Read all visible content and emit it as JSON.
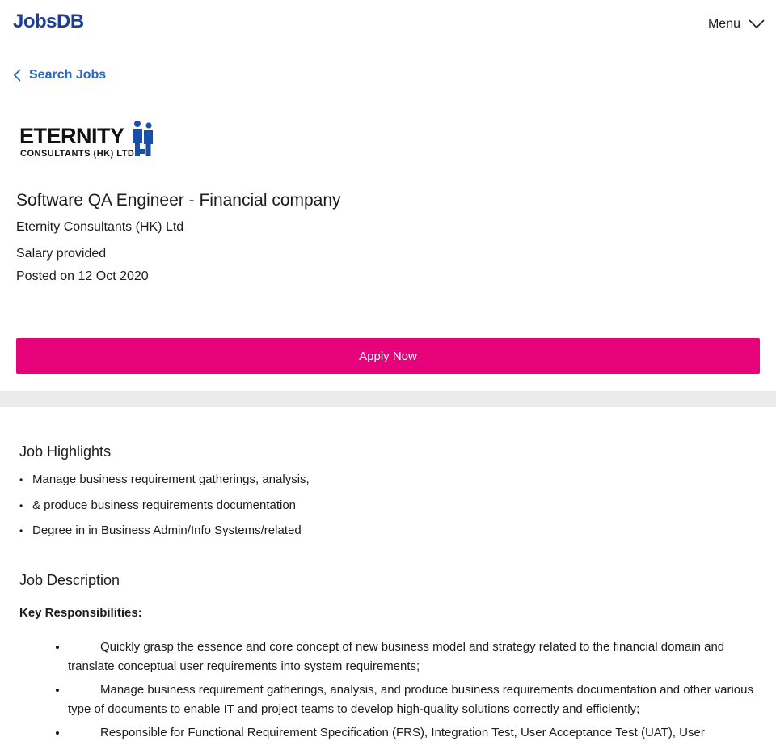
{
  "header": {
    "logo_text": "JobsDB",
    "menu_label": "Menu"
  },
  "nav": {
    "back_label": "Search Jobs"
  },
  "job": {
    "company_logo_text": "ETERNITY",
    "company_logo_subtext": "CONSULTANTS (HK) LTD",
    "title": "Software QA Engineer - Financial company",
    "company": "Eternity Consultants (HK) Ltd",
    "salary": "Salary provided",
    "posted": "Posted on 12 Oct 2020",
    "apply_label": "Apply Now"
  },
  "highlights": {
    "heading": "Job Highlights",
    "items": [
      "Manage business requirement gatherings, analysis,",
      "& produce business requirements documentation",
      "Degree in in Business Admin/Info Systems/related"
    ]
  },
  "description": {
    "heading": "Job Description",
    "subheading": "Key Responsibilities:",
    "items": [
      "Quickly grasp the essence and core concept of new business model and strategy related to the financial domain and translate conceptual user requirements into system requirements;",
      "Manage business requirement gatherings, analysis, and produce business requirements documentation and other various type of documents to enable IT and project teams to develop high-quality solutions correctly and efficiently;",
      "Responsible for Functional Requirement Specification (FRS), Integration Test, User Acceptance Test (UAT), User"
    ]
  },
  "colors": {
    "brand": "#1c3f94",
    "link": "#2765cf",
    "apply": "#e60278",
    "band": "#ebebeb"
  }
}
